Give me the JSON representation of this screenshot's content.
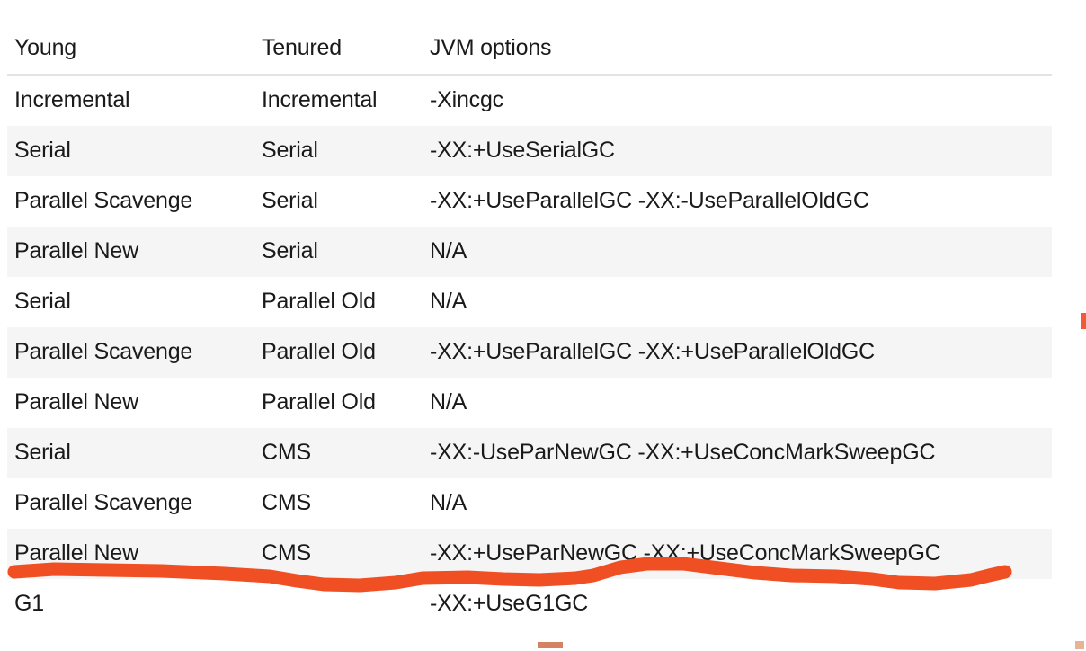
{
  "table": {
    "columns": [
      "Young",
      "Tenured",
      "JVM options"
    ],
    "rows": [
      {
        "young": "Incremental",
        "tenured": "Incremental",
        "jvm": "-Xincgc"
      },
      {
        "young": "Serial",
        "tenured": "Serial",
        "jvm": "-XX:+UseSerialGC"
      },
      {
        "young": "Parallel Scavenge",
        "tenured": "Serial",
        "jvm": "-XX:+UseParallelGC -XX:-UseParallelOldGC"
      },
      {
        "young": "Parallel New",
        "tenured": "Serial",
        "jvm": "N/A"
      },
      {
        "young": "Serial",
        "tenured": "Parallel Old",
        "jvm": "N/A"
      },
      {
        "young": "Parallel Scavenge",
        "tenured": "Parallel Old",
        "jvm": "-XX:+UseParallelGC -XX:+UseParallelOldGC"
      },
      {
        "young": "Parallel New",
        "tenured": "Parallel Old",
        "jvm": "N/A"
      },
      {
        "young": "Serial",
        "tenured": "CMS",
        "jvm": "-XX:-UseParNewGC -XX:+UseConcMarkSweepGC"
      },
      {
        "young": "Parallel Scavenge",
        "tenured": "CMS",
        "jvm": "N/A"
      },
      {
        "young": "Parallel New",
        "tenured": "CMS",
        "jvm": "-XX:+UseParNewGC -XX:+UseConcMarkSweepGC"
      },
      {
        "young": "G1",
        "tenured": "",
        "jvm": "-XX:+UseG1GC"
      }
    ]
  },
  "annotation": {
    "ink_color": "#F04E23",
    "underline_target_row": "Parallel New / CMS"
  },
  "colors": {
    "stripe": "#F5F5F5",
    "background": "#FFFFFF",
    "text": "#1A1A1A",
    "header_rule": "#E3E3E3",
    "ink": "#F04E23"
  }
}
